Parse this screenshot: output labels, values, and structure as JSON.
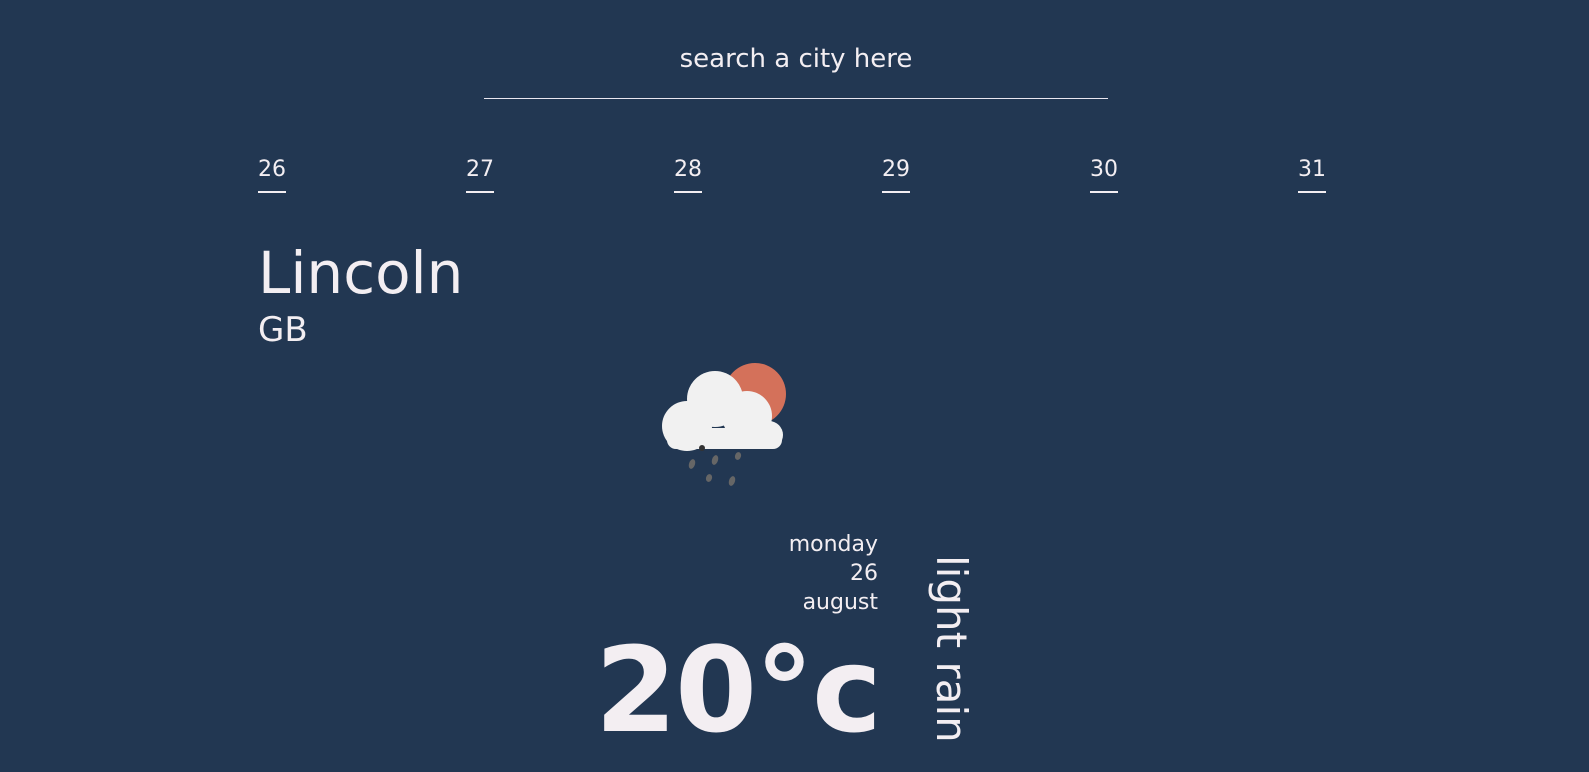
{
  "search": {
    "placeholder": "search a city here",
    "value": ""
  },
  "days": [
    "26",
    "27",
    "28",
    "29",
    "30",
    "31"
  ],
  "location": {
    "city": "Lincoln",
    "country": "GB"
  },
  "forecast": {
    "weekday": "monday",
    "day": "26",
    "month": "august",
    "temperature": "20°c",
    "condition": "light rain",
    "icon": "cloud-sun-rain-icon"
  },
  "colors": {
    "background": "#223752",
    "text": "#f3eef2",
    "sun": "#d4715a",
    "cloud": "#f1f1f1",
    "rain": "#666666"
  }
}
